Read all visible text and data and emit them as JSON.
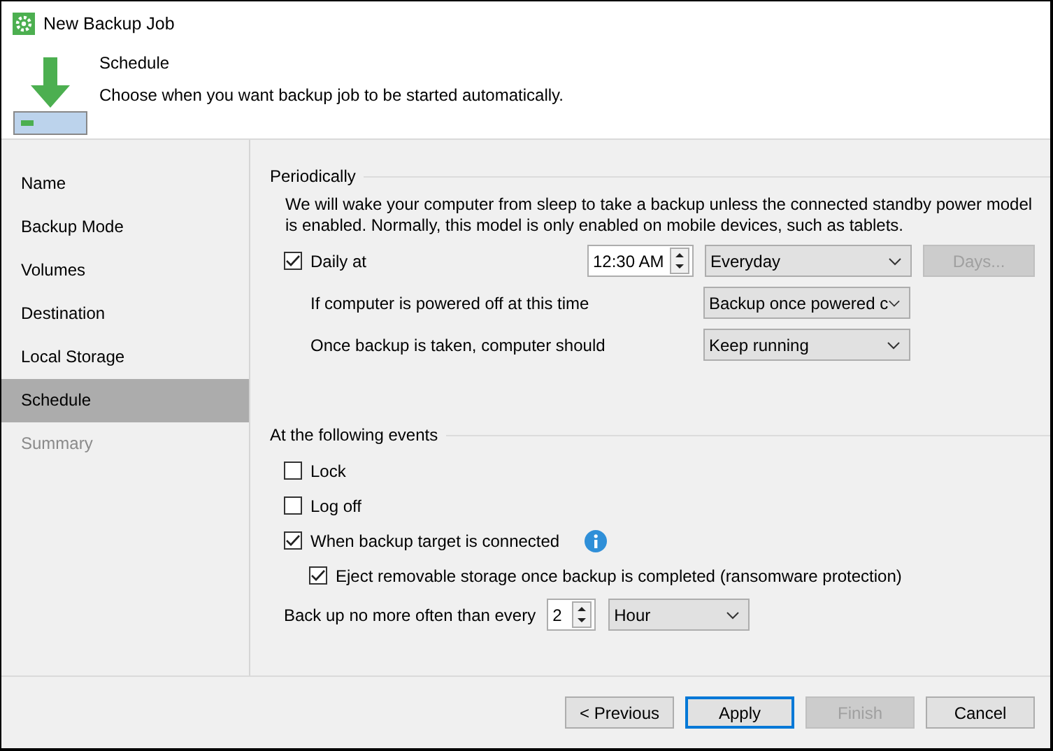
{
  "window": {
    "title": "New Backup Job"
  },
  "header": {
    "title": "Schedule",
    "subtitle": "Choose when you want backup job to be started automatically."
  },
  "sidebar": {
    "items": [
      {
        "label": "Name",
        "selected": false,
        "disabled": false
      },
      {
        "label": "Backup Mode",
        "selected": false,
        "disabled": false
      },
      {
        "label": "Volumes",
        "selected": false,
        "disabled": false
      },
      {
        "label": "Destination",
        "selected": false,
        "disabled": false
      },
      {
        "label": "Local Storage",
        "selected": false,
        "disabled": false
      },
      {
        "label": "Schedule",
        "selected": true,
        "disabled": false
      },
      {
        "label": "Summary",
        "selected": false,
        "disabled": true
      }
    ]
  },
  "periodically": {
    "heading": "Periodically",
    "description": "We will wake your computer from sleep to take a backup unless the connected standby power model is enabled. Normally, this model is only enabled on mobile devices, such as tablets.",
    "daily": {
      "label": "Daily at",
      "checked": true
    },
    "time": {
      "value": "12:30 AM"
    },
    "frequency": {
      "value": "Everyday"
    },
    "days_button": {
      "label": "Days...",
      "disabled": true
    },
    "rows": [
      {
        "label": "If computer is powered off at this time",
        "value": "Backup once powered c"
      },
      {
        "label": "Once backup is taken, computer should",
        "value": "Keep running"
      }
    ]
  },
  "events": {
    "heading": "At the following events",
    "options": [
      {
        "label": "Lock",
        "checked": false,
        "info": false
      },
      {
        "label": "Log off",
        "checked": false,
        "info": false
      },
      {
        "label": "When backup target is connected",
        "checked": true,
        "info": true,
        "children": [
          {
            "label": "Eject removable storage once backup is completed (ransomware protection)",
            "checked": true,
            "info": false
          }
        ]
      }
    ]
  },
  "throttle": {
    "label": "Back up no more often than every",
    "value": "2",
    "unit": "Hour"
  },
  "buttons": [
    {
      "label": "< Previous",
      "focused": false,
      "disabled": false
    },
    {
      "label": "Apply",
      "focused": true,
      "disabled": false
    },
    {
      "label": "Finish",
      "focused": false,
      "disabled": true
    },
    {
      "label": "Cancel",
      "focused": false,
      "disabled": false
    }
  ]
}
